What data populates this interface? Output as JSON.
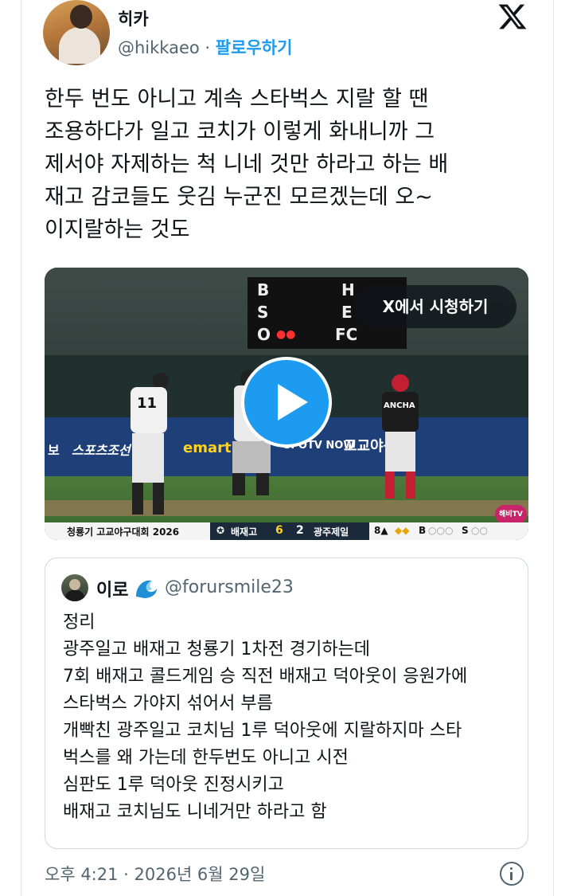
{
  "author": {
    "name": "히카",
    "handle": "@hikkaeo",
    "separator": "·",
    "follow_label": "팔로우하기"
  },
  "tweet": {
    "text": "한두 번도 아니고 계속 스타벅스 지랄 할 땐\n조용하다가 일고 코치가 이렇게 화내니까 그\n제서야 자제하는 척 니네 것만 하라고 하는 배\n재고 감코들도 웃김 누군진 모르겠는데 오~\n이지랄하는 것도"
  },
  "media": {
    "watch_on_x_label": "X에서 시청하기",
    "scoreboard": {
      "b": "B",
      "s": "S",
      "o": "O",
      "h": "H",
      "e": "E",
      "fc": "FC"
    },
    "wall_ads": [
      "보",
      "스포츠조선",
      "emart",
      "SPOTV NOW",
      "고교야구"
    ],
    "player_number": "11",
    "player_jersey": "ANCHA",
    "logo_corner": "해비TV",
    "score_bar": {
      "tournament": "청룡기 고교야구대회 2026",
      "team_home": "배재고",
      "score_home": "6",
      "score_away": "2",
      "team_away": "광주제일",
      "inning": "8▲",
      "count_b": "B",
      "count_s": "S"
    }
  },
  "quote": {
    "name": "이로",
    "handle": "@forursmile23",
    "text": "정리\n광주일고 배재고 청룡기 1차전 경기하는데\n7회 배재고 콜드게임 승 직전 배재고 덕아웃이 응원가에\n스타벅스 가야지 섞어서 부름\n개빡친 광주일고 코치님 1루 덕아웃에 지랄하지마 스타\n벅스를 왜 가는데 한두번도 아니고 시전\n심판도 1루 덕아웃 진정시키고\n배재고 코치님도 니네거만 하라고 함"
  },
  "meta": {
    "timestamp": "오후 4:21 · 2026년 6월 29일"
  },
  "colors": {
    "accent": "#1d9bf0",
    "muted": "#536471",
    "text": "#0f1419"
  },
  "icons": [
    "x-logo-icon",
    "play-icon",
    "wave-emoji-icon",
    "info-icon"
  ]
}
